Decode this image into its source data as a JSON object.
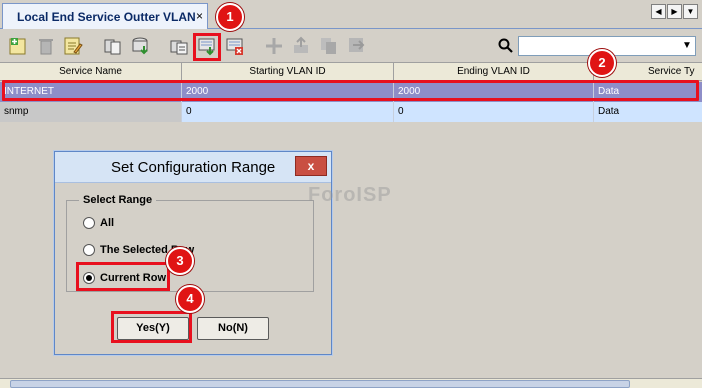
{
  "tab": {
    "label": "Local End Service Outter VLAN",
    "close": "×"
  },
  "nav": {
    "prev": "◀",
    "next": "▶",
    "menu": "▼"
  },
  "search": {
    "value": "",
    "dropdown": "▼"
  },
  "table": {
    "headers": [
      "Service Name",
      "Starting VLAN ID",
      "Ending VLAN ID",
      "Service Ty"
    ],
    "rows": [
      [
        "INTERNET",
        "2000",
        "2000",
        "Data"
      ],
      [
        "snmp",
        "0",
        "0",
        "Data"
      ]
    ]
  },
  "dialog": {
    "title": "Set Configuration Range",
    "close": "x",
    "group_label": "Select Range",
    "options": [
      "All",
      "The Selected Row",
      "Current Row"
    ],
    "selected_option": "Current Row",
    "yes_label": "Yes(Y)",
    "no_label": "No(N)"
  },
  "watermark": "ForoISP",
  "callouts": [
    "1",
    "2",
    "3",
    "4"
  ],
  "colors": {
    "selected_row": "#8e8ec8",
    "row_bg": "#cfe4ff",
    "annotation": "#e8101e"
  }
}
